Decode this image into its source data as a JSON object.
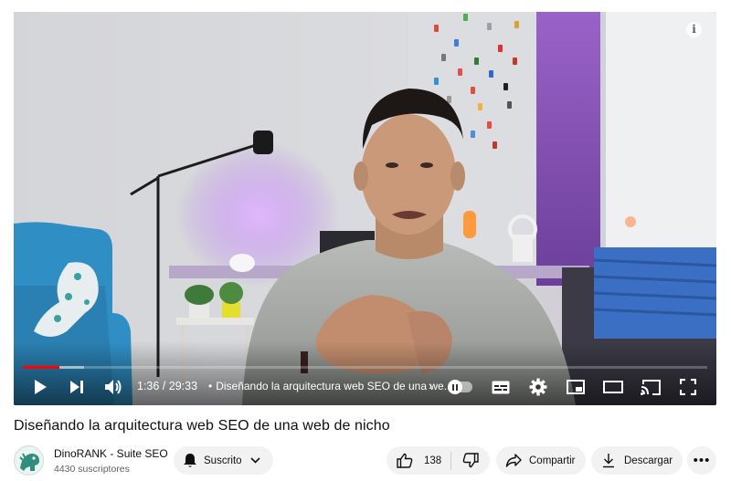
{
  "player": {
    "time": "1:36 / 29:33",
    "chapter_separator": "•",
    "chapter_title": "Diseñando la arquitectura web SEO de una we...",
    "progress_played_fraction": 0.054,
    "progress_loaded_fraction": 0.09,
    "info_icon_glyph": "i",
    "chapter_chevron": "›",
    "icons": [
      "play-icon",
      "next-icon",
      "volume-icon",
      "autoplay-toggle",
      "subtitles-icon",
      "settings-icon",
      "miniplayer-icon",
      "theater-icon",
      "cast-icon",
      "fullscreen-icon"
    ]
  },
  "video": {
    "title": "Diseñando la arquitectura web SEO de una web de nicho"
  },
  "channel": {
    "name": "DinoRANK - Suite SEO",
    "subscribers": "4430 suscriptores",
    "subscribe_label": "Suscrito"
  },
  "actions": {
    "like_count": "138",
    "share_label": "Compartir",
    "download_label": "Descargar",
    "more_label": "•••"
  },
  "colors": {
    "progress_red": "#ff0000",
    "pill_bg": "#f2f2f2",
    "text": "#0f0f0f",
    "secondary_text": "#606060"
  }
}
